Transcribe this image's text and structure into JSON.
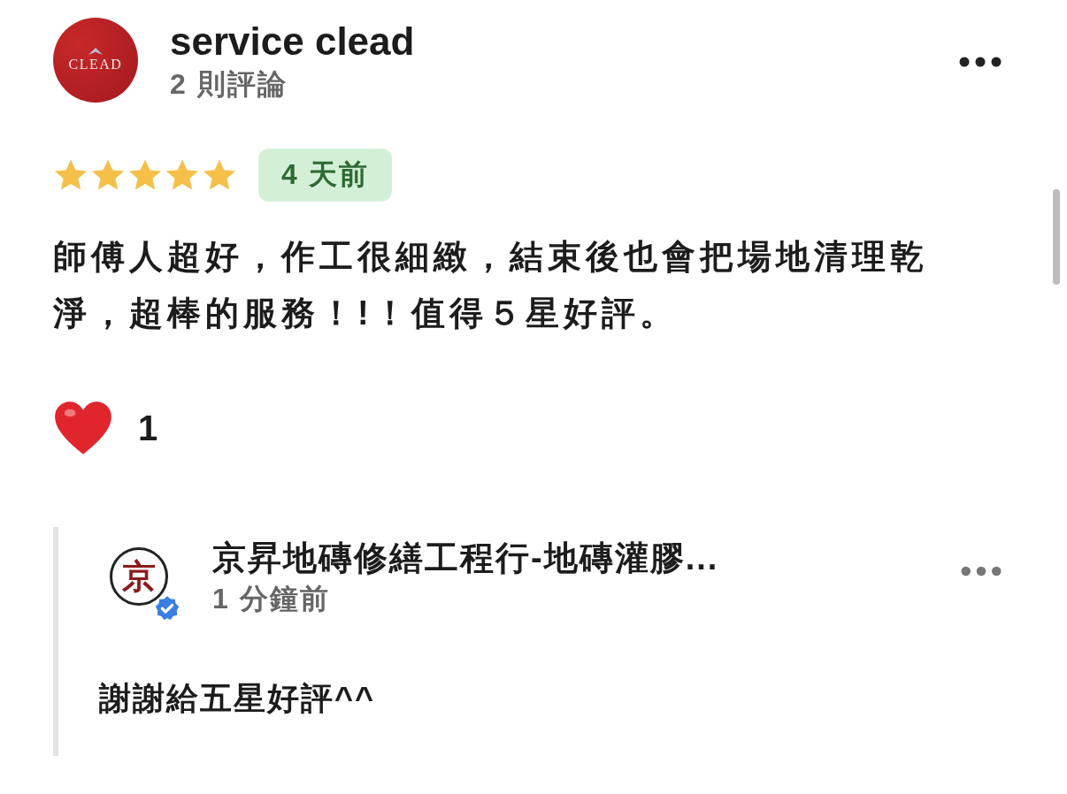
{
  "review": {
    "avatar_text": "CLEAD",
    "author": "service clead",
    "review_count": "2 則評論",
    "stars": 5,
    "time": "4 天前",
    "text": "師傅人超好，作工很細緻，結束後也會把場地清理乾淨，超棒的服務！!！值得５星好評。",
    "reactions": "1"
  },
  "reply": {
    "avatar_text": "京",
    "verified": true,
    "author": "京昇地磚修繕工程行-地磚灌膠...",
    "time": "1 分鐘前",
    "text": "謝謝給五星好評^^"
  }
}
